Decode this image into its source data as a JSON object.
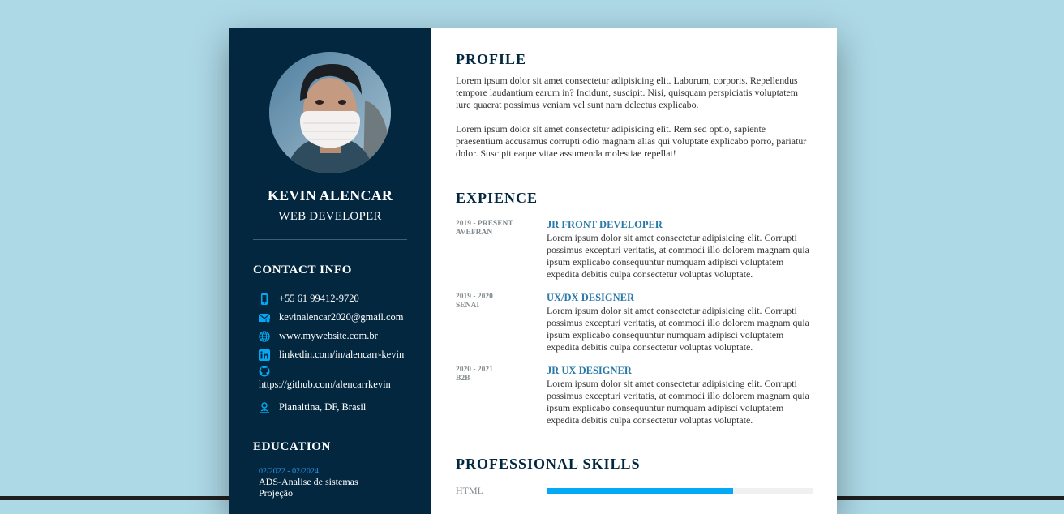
{
  "colors": {
    "page_bg": "#add8e6",
    "sidebar_bg": "#03273f",
    "accent": "#03a9f4",
    "heading": "#03273f",
    "job_title": "#2a7aa8"
  },
  "sidebar": {
    "photo_icon": "person-photo-icon",
    "name": "KEVIN ALENCAR",
    "role": "WEB DEVELOPER",
    "contact": {
      "title": "CONTACT INFO",
      "items": [
        {
          "icon": "phone-icon",
          "text": "+55 61 99412-9720"
        },
        {
          "icon": "mail-icon",
          "text": "kevinalencar2020@gmail.com"
        },
        {
          "icon": "globe-icon",
          "text": "www.mywebsite.com.br"
        },
        {
          "icon": "linkedin-icon",
          "text": "linkedin.com/in/alencarr-kevin"
        },
        {
          "icon": "github-icon",
          "text": "https://github.com/alencarrkevin"
        },
        {
          "icon": "location-icon",
          "text": "Planaltina, DF, Brasil"
        }
      ]
    },
    "education": {
      "title": "EDUCATION",
      "items": [
        {
          "year": "02/2022 - 02/2024",
          "degree": "ADS-Analise de sistemas",
          "school": "Projeção"
        }
      ]
    }
  },
  "main": {
    "profile": {
      "title": "PROFILE",
      "paragraphs": [
        "Lorem ipsum dolor sit amet consectetur adipisicing elit. Laborum, corporis. Repellendus tempore laudantium earum in? Incidunt, suscipit. Nisi, quisquam perspiciatis voluptatem iure quaerat possimus veniam vel sunt nam delectus explicabo.",
        "Lorem ipsum dolor sit amet consectetur adipisicing elit. Rem sed optio, sapiente praesentium accusamus corrupti odio magnam alias qui voluptate explicabo porro, pariatur dolor. Suscipit eaque vitae assumenda molestiae repellat!"
      ]
    },
    "experience": {
      "title": "EXPIENCE",
      "items": [
        {
          "years": "2019 - PRESENT",
          "company": "AVEFRAN",
          "job": "JR FRONT DEVELOPER",
          "desc": "Lorem ipsum dolor sit amet consectetur adipisicing elit. Corrupti possimus excepturi veritatis, at commodi illo dolorem magnam quia ipsum explicabo consequuntur numquam adipisci voluptatem expedita debitis culpa consectetur voluptas voluptate."
        },
        {
          "years": "2019 - 2020",
          "company": "SENAI",
          "job": "UX/DX DESIGNER",
          "desc": "Lorem ipsum dolor sit amet consectetur adipisicing elit. Corrupti possimus excepturi veritatis, at commodi illo dolorem magnam quia ipsum explicabo consequuntur numquam adipisci voluptatem expedita debitis culpa consectetur voluptas voluptate."
        },
        {
          "years": "2020 - 2021",
          "company": "B2B",
          "job": "JR UX DESIGNER",
          "desc": "Lorem ipsum dolor sit amet consectetur adipisicing elit. Corrupti possimus excepturi veritatis, at commodi illo dolorem magnam quia ipsum explicabo consequuntur numquam adipisci voluptatem expedita debitis culpa consectetur voluptas voluptate."
        }
      ]
    },
    "skills": {
      "title": "PROFESSIONAL SKILLS",
      "items": [
        {
          "name": "HTML",
          "level_percent": 70
        }
      ]
    }
  }
}
